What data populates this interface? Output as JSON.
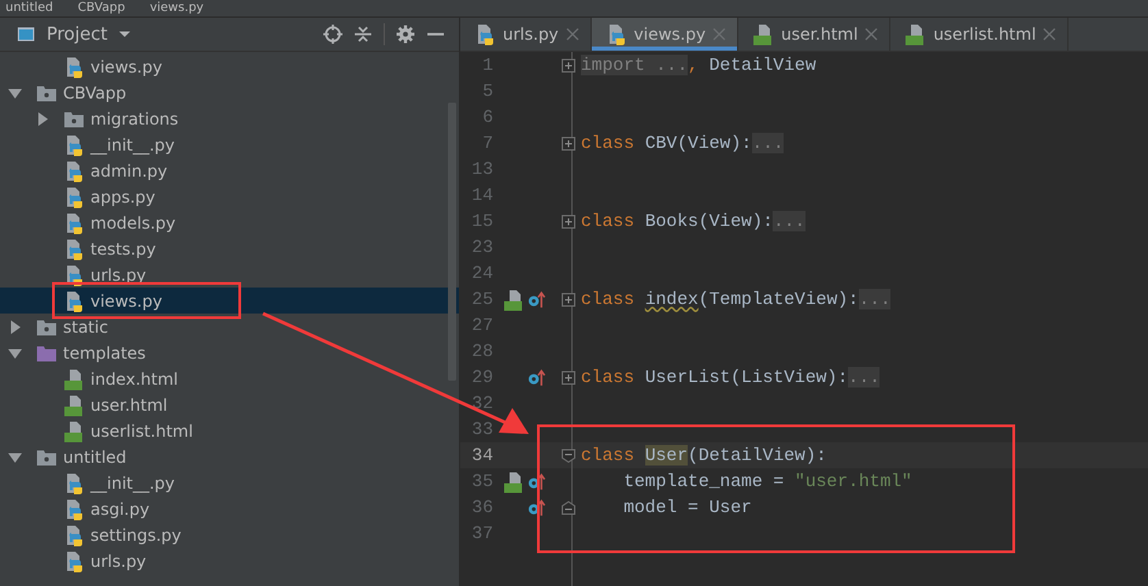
{
  "breadcrumb": [
    "untitled",
    "CBVapp",
    "views.py"
  ],
  "project_panel": {
    "title": "Project",
    "top_items": [
      {
        "name": "views.py",
        "kind": "py",
        "selected": false
      }
    ],
    "tree": [
      {
        "name": "CBVapp",
        "kind": "package",
        "expanded": true,
        "children": [
          {
            "name": "migrations",
            "kind": "package",
            "expanded": false
          },
          {
            "name": "__init__.py",
            "kind": "py",
            "selected": false
          },
          {
            "name": "admin.py",
            "kind": "py",
            "selected": false
          },
          {
            "name": "apps.py",
            "kind": "py",
            "selected": false
          },
          {
            "name": "models.py",
            "kind": "py",
            "selected": false
          },
          {
            "name": "tests.py",
            "kind": "py",
            "selected": false
          },
          {
            "name": "urls.py",
            "kind": "py",
            "selected": false
          },
          {
            "name": "views.py",
            "kind": "py",
            "selected": true
          }
        ]
      },
      {
        "name": "static",
        "kind": "package",
        "expanded": false
      },
      {
        "name": "templates",
        "kind": "templates",
        "expanded": true,
        "children": [
          {
            "name": "index.html",
            "kind": "html",
            "selected": false
          },
          {
            "name": "user.html",
            "kind": "html",
            "selected": false
          },
          {
            "name": "userlist.html",
            "kind": "html",
            "selected": false
          }
        ]
      },
      {
        "name": "untitled",
        "kind": "package",
        "expanded": true,
        "children": [
          {
            "name": "__init__.py",
            "kind": "py",
            "selected": false
          },
          {
            "name": "asgi.py",
            "kind": "py",
            "selected": false
          },
          {
            "name": "settings.py",
            "kind": "py",
            "selected": false
          },
          {
            "name": "urls.py",
            "kind": "py",
            "selected": false
          }
        ]
      }
    ]
  },
  "tabs": [
    {
      "label": "urls.py",
      "kind": "py",
      "selected": false
    },
    {
      "label": "views.py",
      "kind": "py",
      "selected": true
    },
    {
      "label": "user.html",
      "kind": "html",
      "selected": false
    },
    {
      "label": "userlist.html",
      "kind": "html",
      "selected": false
    }
  ],
  "code_lines": [
    {
      "num": "1",
      "fold": {
        "kind": "expand"
      },
      "current": false,
      "tokens": [
        {
          "text": "import ...",
          "kind": "folded"
        },
        {
          "text": ",",
          "kind": "keyword"
        },
        {
          "text": " DetailView",
          "kind": "plain"
        }
      ]
    },
    {
      "num": "5",
      "current": false
    },
    {
      "num": "6",
      "current": false
    },
    {
      "num": "7",
      "fold": {
        "kind": "expand"
      },
      "current": false,
      "tokens": [
        {
          "text": "class ",
          "kind": "keyword"
        },
        {
          "text": "CBV(View):",
          "kind": "plain"
        },
        {
          "text": "...",
          "kind": "folded"
        }
      ]
    },
    {
      "num": "13",
      "current": false
    },
    {
      "num": "14",
      "current": false
    },
    {
      "num": "15",
      "fold": {
        "kind": "expand"
      },
      "current": false,
      "tokens": [
        {
          "text": "class ",
          "kind": "keyword"
        },
        {
          "text": "Books(View):",
          "kind": "plain"
        },
        {
          "text": "...",
          "kind": "folded"
        }
      ]
    },
    {
      "num": "23",
      "current": false
    },
    {
      "num": "24",
      "current": false
    },
    {
      "num": "25",
      "fold": {
        "kind": "expand"
      },
      "markers": [
        {
          "kind": "html"
        },
        {
          "kind": "override"
        }
      ],
      "current": false,
      "tokens": [
        {
          "text": "class ",
          "kind": "keyword"
        },
        {
          "text": "index",
          "kind": "warning"
        },
        {
          "text": "(TemplateView):",
          "kind": "plain"
        },
        {
          "text": "...",
          "kind": "folded"
        }
      ]
    },
    {
      "num": "27",
      "current": false
    },
    {
      "num": "28",
      "current": false
    },
    {
      "num": "29",
      "fold": {
        "kind": "expand"
      },
      "markers": [
        {
          "kind": "override"
        }
      ],
      "current": false,
      "tokens": [
        {
          "text": "class ",
          "kind": "keyword"
        },
        {
          "text": "UserList(ListView):",
          "kind": "plain"
        },
        {
          "text": "...",
          "kind": "folded"
        }
      ]
    },
    {
      "num": "32",
      "current": false
    },
    {
      "num": "33",
      "current": false
    },
    {
      "num": "34",
      "fold": {
        "kind": "collapse"
      },
      "current": true,
      "tokens": [
        {
          "text": "class ",
          "kind": "keyword"
        },
        {
          "text": "User",
          "kind": "highlight"
        },
        {
          "text": "(DetailView):",
          "kind": "plain"
        }
      ]
    },
    {
      "num": "35",
      "markers": [
        {
          "kind": "html"
        },
        {
          "kind": "override"
        }
      ],
      "current": false,
      "tokens": [
        {
          "text": "    template_name = ",
          "kind": "plain"
        },
        {
          "text": "\"user.html\"",
          "kind": "string"
        }
      ]
    },
    {
      "num": "36",
      "fold": {
        "kind": "end"
      },
      "markers": [
        {
          "kind": "override"
        }
      ],
      "current": false,
      "tokens": [
        {
          "text": "    model = User",
          "kind": "plain"
        }
      ]
    },
    {
      "num": "37",
      "current": false
    }
  ]
}
